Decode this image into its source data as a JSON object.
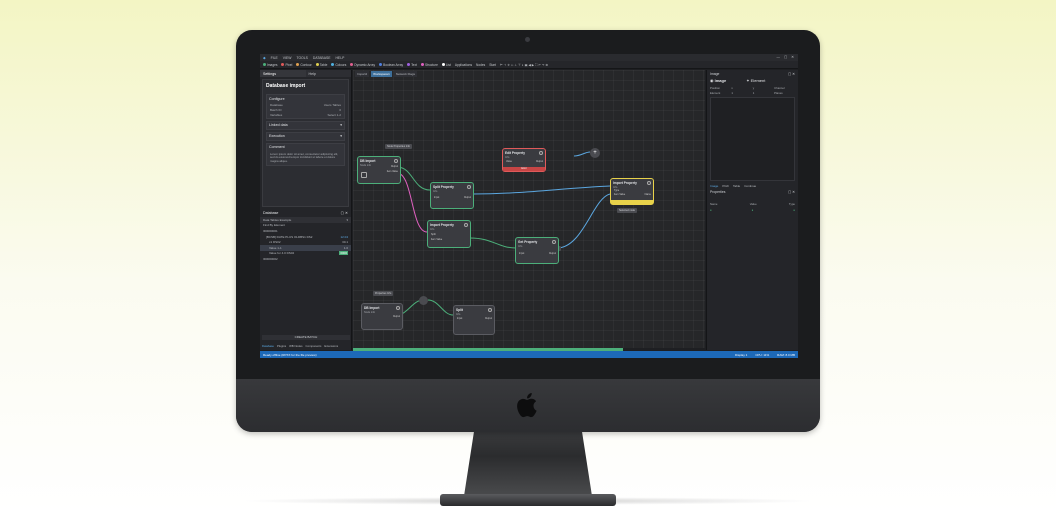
{
  "menu": {
    "items": [
      "FILE",
      "VIEW",
      "TOOLS",
      "DATABASE",
      "HELP"
    ]
  },
  "toolbar": {
    "items": [
      {
        "label": "Images",
        "color": "#4caf7a"
      },
      {
        "label": "Pixel",
        "color": "#e05a5a"
      },
      {
        "label": "Contour",
        "color": "#e0a050"
      },
      {
        "label": "Table",
        "color": "#e0d050"
      },
      {
        "label": "Colours",
        "color": "#50b0e0"
      },
      {
        "label": "Dynamic Array",
        "color": "#e06090"
      },
      {
        "label": "Boolean Array",
        "color": "#5080e0"
      },
      {
        "label": "Text",
        "color": "#a060e0"
      },
      {
        "label": "Structure",
        "color": "#e060c0"
      },
      {
        "label": "List",
        "color": "#ffffff"
      },
      {
        "label": "Applications",
        "color": ""
      },
      {
        "label": "Nodes",
        "color": ""
      },
      {
        "label": "Start",
        "color": ""
      }
    ]
  },
  "left_panel": {
    "tabs": [
      "Settings",
      "Help"
    ],
    "title": "Database import",
    "configure": {
      "heading": "Configure",
      "rows": [
        {
          "key": "Database",
          "value": "Users Tables"
        },
        {
          "key": "Batch ID",
          "value": "0"
        },
        {
          "key": "Variables",
          "value": "Select 1-2"
        }
      ]
    },
    "linked_data": "Linked data",
    "execution": "Execution",
    "comment_heading": "Comment",
    "comment_text": "Lorem ipsum dolor sit amet, consectetur adipiscing elit, sed do eiusmod tempor incididunt ut labore et dolore magna aliqua.",
    "database": {
      "heading": "Database",
      "selector": "Data Tables Example",
      "filter": "Find By Element",
      "tree": [
        {
          "label": "ID0000001",
          "value": ""
        },
        {
          "label": "[BCSB] DATE PLUS OLDBS1 DS2",
          "value": "12.04"
        },
        {
          "label": "x1 DS02",
          "value": "30.1"
        },
        {
          "label": "Value 1-1",
          "value": "1.0"
        },
        {
          "label": "Value for 4.0 DS02",
          "value": "0000"
        },
        {
          "label": "ID0000002",
          "value": ""
        }
      ]
    },
    "create_batch": "CREATE BATCH",
    "bottom_tabs": [
      "Database",
      "Plugins",
      "WB Nodes",
      "Components",
      "Extensions"
    ]
  },
  "canvas": {
    "tabs": [
      "Import2",
      "Workspace1",
      "Network Flags"
    ],
    "nodes": [
      {
        "title": "DB Import",
        "sub": "Node info"
      },
      {
        "title": "Split Property",
        "sub": "Info"
      },
      {
        "title": "Edit Property",
        "sub": "Info"
      },
      {
        "title": "Import Property",
        "sub": "Info"
      },
      {
        "title": "Get Property",
        "sub": "Info"
      },
      {
        "title": "Import Property",
        "sub": "Info"
      },
      {
        "title": "DB Import",
        "sub": "Node info"
      },
      {
        "title": "Split",
        "sub": "Info"
      }
    ],
    "ports": {
      "value": "Value",
      "output": "Output",
      "input": "Input",
      "item_value": "Item Value",
      "split": "Split",
      "type": "Type",
      "name": "Name"
    },
    "error_banner": "Error",
    "notes": [
      "Node Properties Info",
      "Step 2 or after",
      "Selected node",
      "Properties Info"
    ]
  },
  "right_panel": {
    "header": "Image",
    "tabs": [
      "Image",
      "Element"
    ],
    "grid": [
      "Position",
      "x",
      "y",
      "Channel",
      "Element",
      "1",
      "1",
      "Planes"
    ],
    "subtabs": [
      "Image",
      "Pitch",
      "Table",
      "Continue"
    ],
    "properties": "Properties",
    "cols": [
      "Name",
      "Value",
      "Type"
    ]
  },
  "status": {
    "left": "Ready offline (RPXX for the file preview)",
    "right": [
      "Display 1",
      "CPU: 11%",
      "RAM: 8.0 MB"
    ]
  }
}
